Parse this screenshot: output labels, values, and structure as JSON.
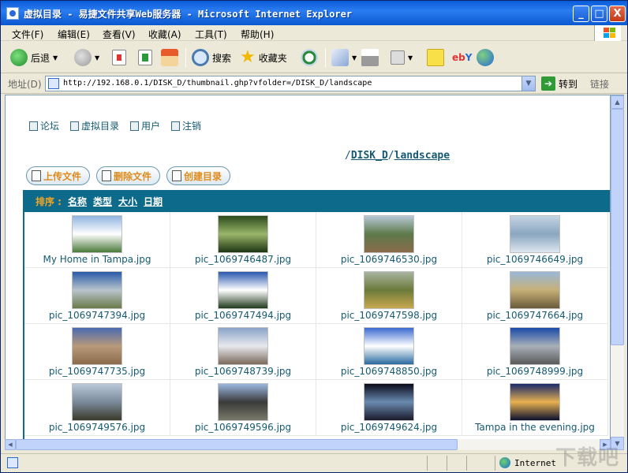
{
  "window": {
    "title": "虚拟目录 - 易捷文件共享Web服务器 - Microsoft Internet Explorer",
    "buttons": {
      "min": "_",
      "max": "□",
      "close": "X"
    }
  },
  "menu": [
    "文件(F)",
    "编辑(E)",
    "查看(V)",
    "收藏(A)",
    "工具(T)",
    "帮助(H)"
  ],
  "toolbar": {
    "back": "后退",
    "search": "搜索",
    "favorites": "收藏夹"
  },
  "address": {
    "label": "地址(D)",
    "url": "http://192.168.0.1/DISK_D/thumbnail.ghp?vfolder=/DISK_D/landscape",
    "go": "转到",
    "links": "链接"
  },
  "page": {
    "nav": [
      "论坛",
      "虚拟目录",
      "用户",
      "注销"
    ],
    "path": {
      "sep": "/",
      "parts": [
        "DISK_D",
        "landscape"
      ]
    },
    "actions": [
      "上传文件",
      "删除文件",
      "创建目录"
    ],
    "sort": {
      "label": "排序 :",
      "options": [
        "名称",
        "类型",
        "大小",
        "日期"
      ]
    },
    "files": [
      {
        "name": "My Home in Tampa.jpg",
        "colors": [
          "#8fb4e0",
          "#ffffff",
          "#4a7a3a"
        ]
      },
      {
        "name": "pic_1069746487.jpg",
        "colors": [
          "#2b4a1c",
          "#9ab56a",
          "#1d3512"
        ]
      },
      {
        "name": "pic_1069746530.jpg",
        "colors": [
          "#b8c8d6",
          "#5c7a4a",
          "#8a6a4a"
        ]
      },
      {
        "name": "pic_1069746649.jpg",
        "colors": [
          "#c4d4e4",
          "#8aa6c0",
          "#dde6ee"
        ]
      },
      {
        "name": "pic_1069747394.jpg",
        "colors": [
          "#2a5aa8",
          "#b8c4cc",
          "#6a7a4a"
        ]
      },
      {
        "name": "pic_1069747494.jpg",
        "colors": [
          "#2a58b0",
          "#ffffff",
          "#1f3a1c"
        ]
      },
      {
        "name": "pic_1069747598.jpg",
        "colors": [
          "#a8b4a0",
          "#6b7a3a",
          "#c8a850"
        ]
      },
      {
        "name": "pic_1069747664.jpg",
        "colors": [
          "#9ab8d8",
          "#c6b078",
          "#6a5a3a"
        ]
      },
      {
        "name": "pic_1069747735.jpg",
        "colors": [
          "#4a6ab0",
          "#b89a7a",
          "#8a6a4a"
        ]
      },
      {
        "name": "pic_1069748739.jpg",
        "colors": [
          "#8aa4c8",
          "#e8e8ee",
          "#7a6a5a"
        ]
      },
      {
        "name": "pic_1069748850.jpg",
        "colors": [
          "#3a6ad0",
          "#ffffff",
          "#2a6aa0"
        ]
      },
      {
        "name": "pic_1069748999.jpg",
        "colors": [
          "#1a4aa8",
          "#a8b0b8",
          "#5a5a5a"
        ]
      },
      {
        "name": "pic_1069749576.jpg",
        "colors": [
          "#b8c8d8",
          "#7a8a9a",
          "#3a3a2a"
        ]
      },
      {
        "name": "pic_1069749596.jpg",
        "colors": [
          "#9ab8e0",
          "#3a3a3a",
          "#7a7a6a"
        ]
      },
      {
        "name": "pic_1069749624.jpg",
        "colors": [
          "#0a0a1a",
          "#6a8ab0",
          "#1a1a2a"
        ]
      },
      {
        "name": "Tampa in the evening.jpg",
        "colors": [
          "#1a2a6a",
          "#e8b050",
          "#0a1030"
        ]
      }
    ]
  },
  "status": {
    "zone": "Internet"
  },
  "watermark": "下载吧",
  "colors": {
    "accent": "#0e6a8a",
    "link": "#155a72",
    "sortLabel": "#f5a623"
  }
}
